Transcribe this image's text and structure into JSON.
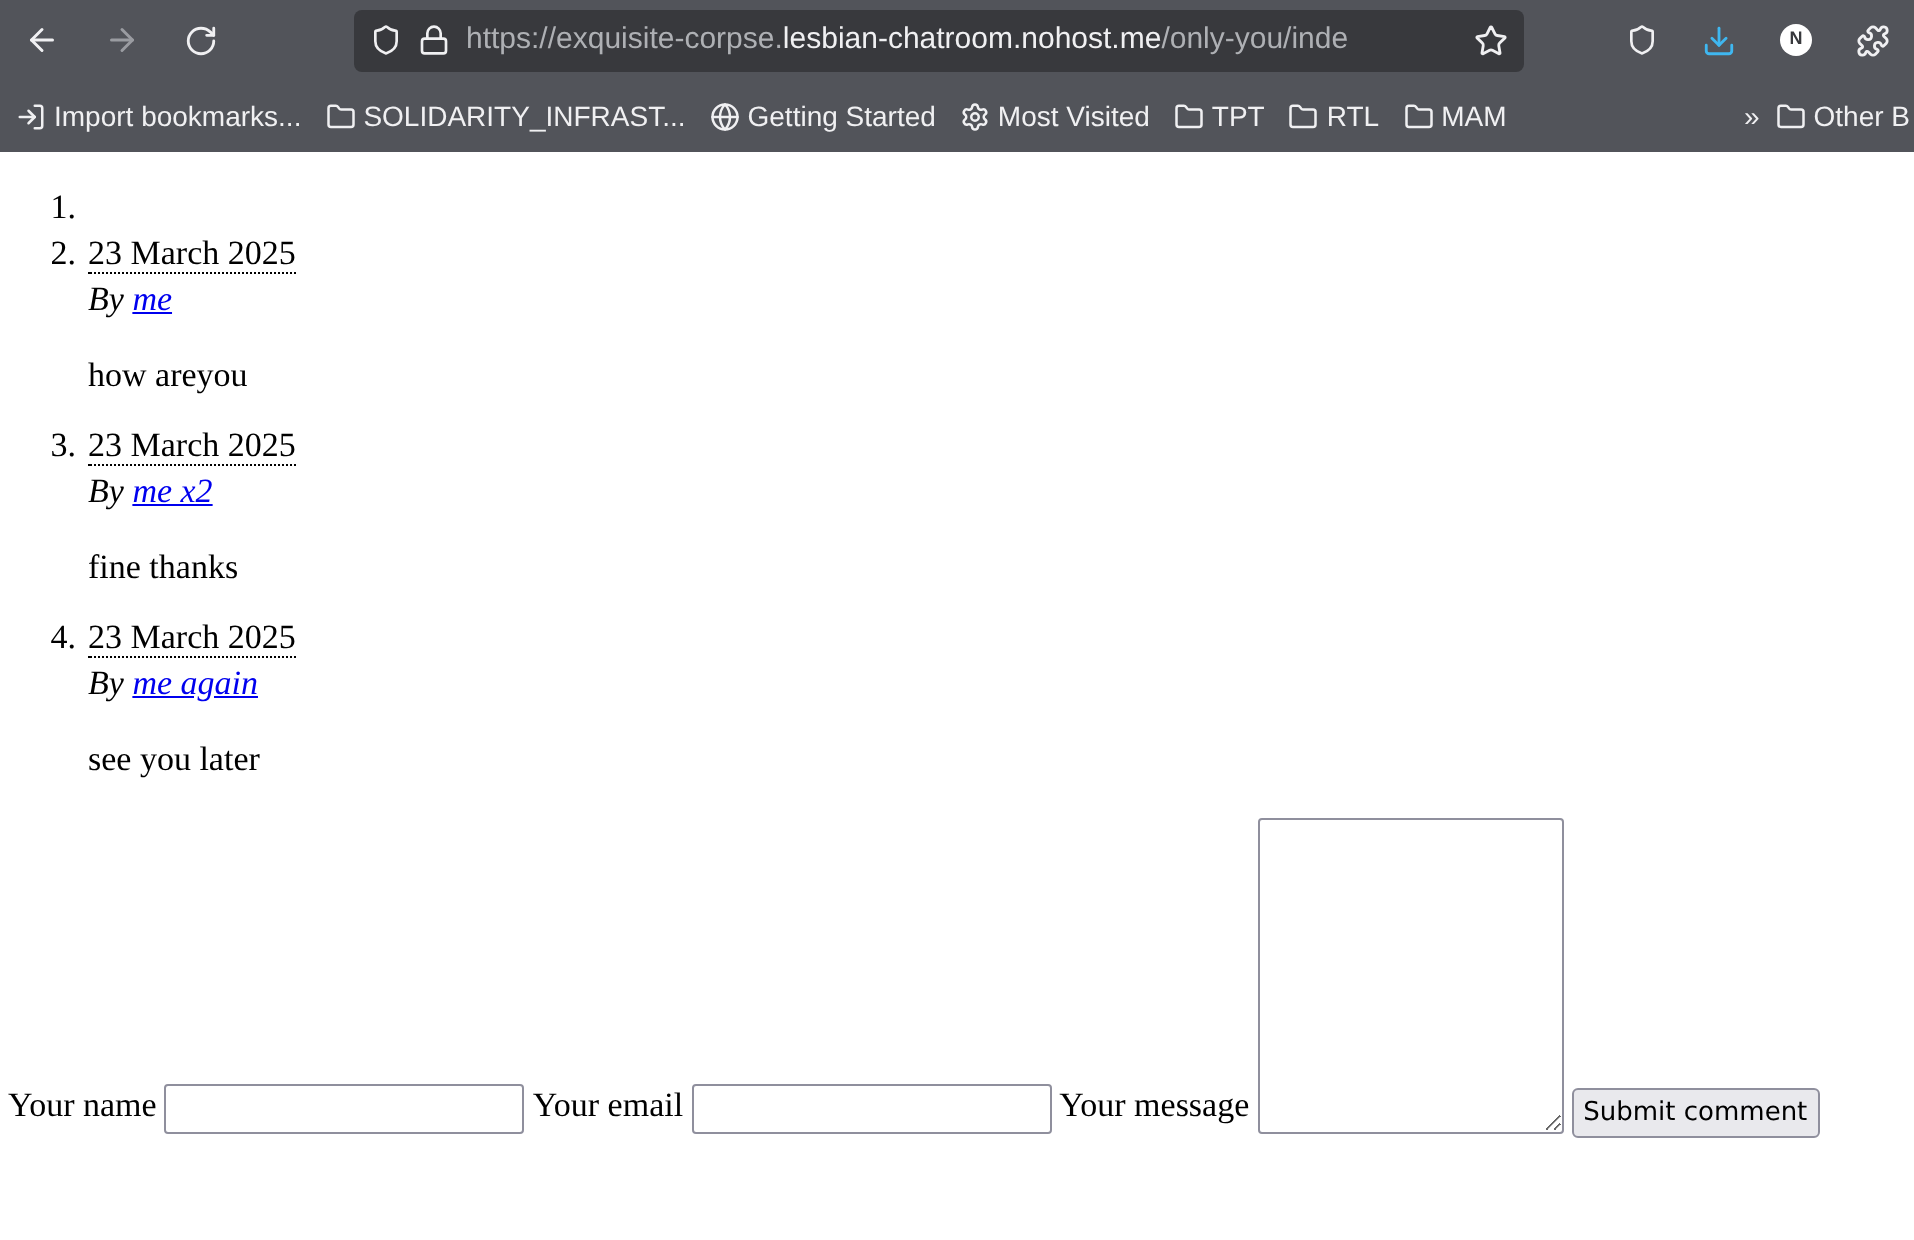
{
  "browser": {
    "url": {
      "scheme": "https://exquisite-corpse.",
      "host": "lesbian-chatroom.nohost.me",
      "path": "/only-you/inde"
    },
    "profile_initial": "N",
    "bookmarks": [
      {
        "kind": "import",
        "label": "Import bookmarks..."
      },
      {
        "kind": "folder",
        "label": "SOLIDARITY_INFRAST..."
      },
      {
        "kind": "globe",
        "label": "Getting Started"
      },
      {
        "kind": "gear",
        "label": "Most Visited"
      },
      {
        "kind": "folder",
        "label": "TPT"
      },
      {
        "kind": "folder",
        "label": "RTL"
      },
      {
        "kind": "folder",
        "label": "MAM"
      }
    ],
    "overflow": "»",
    "other_bookmarks": "Other B"
  },
  "comments": [
    {
      "number": "1."
    },
    {
      "number": "2.",
      "date": "23 March 2025",
      "by": "By",
      "author": "me",
      "message": "how areyou"
    },
    {
      "number": "3.",
      "date": "23 March 2025",
      "by": "By",
      "author": "me x2",
      "message": "fine thanks"
    },
    {
      "number": "4.",
      "date": "23 March 2025",
      "by": "By",
      "author": "me again",
      "message": "see you later"
    }
  ],
  "form": {
    "name_label": "Your name",
    "email_label": "Your email",
    "message_label": "Your message",
    "submit": "Submit comment"
  }
}
